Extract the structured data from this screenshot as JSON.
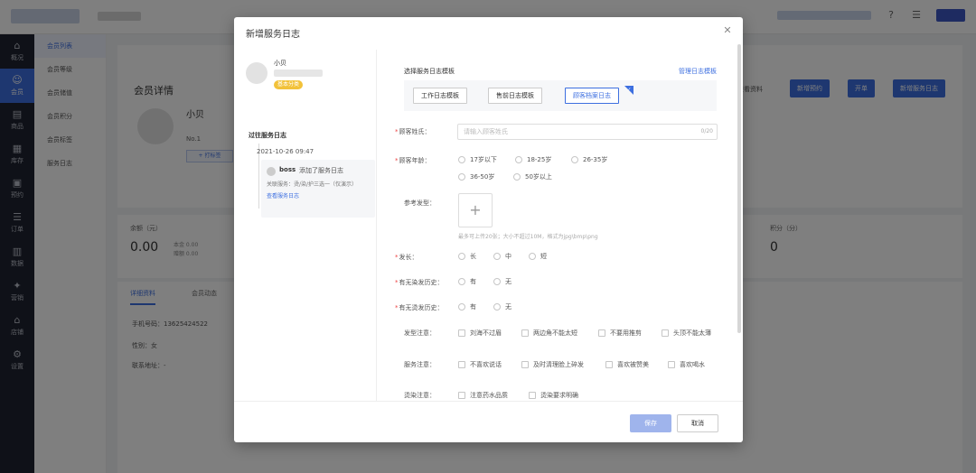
{
  "topbar": {
    "icons": [
      "help-icon",
      "menu-icon"
    ]
  },
  "sidebar": {
    "items": [
      {
        "label": "概况",
        "icon": "home-icon",
        "glyph": "⌂"
      },
      {
        "label": "会员",
        "icon": "member-icon",
        "glyph": "☺"
      },
      {
        "label": "商品",
        "icon": "goods-icon",
        "glyph": "▤"
      },
      {
        "label": "库存",
        "icon": "stock-icon",
        "glyph": "▦"
      },
      {
        "label": "预约",
        "icon": "calendar-icon",
        "glyph": "▣"
      },
      {
        "label": "订单",
        "icon": "order-icon",
        "glyph": "☰"
      },
      {
        "label": "数据",
        "icon": "chart-icon",
        "glyph": "▥"
      },
      {
        "label": "营销",
        "icon": "marketing-icon",
        "glyph": "✦"
      },
      {
        "label": "店铺",
        "icon": "shop-icon",
        "glyph": "⌂"
      },
      {
        "label": "设置",
        "icon": "settings-icon",
        "glyph": "⚙"
      }
    ]
  },
  "subnav": {
    "items": [
      "会员列表",
      "会员等级",
      "会员储值",
      "会员积分",
      "会员标签",
      "服务日志"
    ]
  },
  "member": {
    "page_title": "会员详情",
    "name": "小贝",
    "no": "No.1",
    "tag_btn": "+ 打标签",
    "actions": {
      "more": "查看资料",
      "reserve": "新增预约",
      "bill": "开单",
      "add_log": "新增服务日志"
    }
  },
  "stats": {
    "balance_label": "余额（元）",
    "balance_value": "0.00",
    "balance_principal": "本金 0.00",
    "balance_gift": "赠额 0.00",
    "points_label": "积分（分）",
    "points_value": "0"
  },
  "detail": {
    "tabs": [
      "详细资料",
      "会员动态"
    ],
    "phone": "手机号码：13625424522",
    "gender": "性别：女",
    "address": "联系地址：-"
  },
  "modal": {
    "title": "新增服务日志",
    "customer": {
      "name": "小贝",
      "level": "基本分类"
    },
    "history": {
      "title": "过往服务日志",
      "date": "2021-10-26 09:47",
      "user": "boss",
      "action": "添加了服务日志",
      "detail": "关联服务：烫/染/护三选一（仅演示）",
      "link": "查看服务日志"
    },
    "template": {
      "label": "选择服务日志模板",
      "manage": "管理日志模板",
      "options": [
        "工作日志模板",
        "售前日志模板",
        "顾客档案日志"
      ],
      "selected": 2
    },
    "fields": {
      "name_label": "顾客姓氏：",
      "name_placeholder": "请输入顾客姓氏",
      "name_count": "0/20",
      "age_label": "顾客年龄：",
      "age_options": [
        "17岁以下",
        "18-25岁",
        "26-35岁",
        "36-50岁",
        "50岁以上"
      ],
      "ref_label": "参考发型：",
      "upload_glyph": "+",
      "upload_hint": "最多可上传20张；大小不超过10M，格式为jpg\\bmp\\png",
      "hair_label": "发长：",
      "hair_options": [
        "长",
        "中",
        "短"
      ],
      "dye_label": "有无染发历史：",
      "perm_label": "有无烫发历史：",
      "yes": "有",
      "no": "无",
      "style_note_label": "发型注意：",
      "style_notes": [
        "刘海不过眉",
        "两边角不能太短",
        "不要用推剪",
        "头顶不能太薄"
      ],
      "service_note_label": "服务注意：",
      "service_notes": [
        "不喜欢说话",
        "及时清理脸上碎发",
        "喜欢被赞美",
        "喜欢喝水"
      ],
      "perm_note_label": "烫染注意：",
      "perm_notes": [
        "注意药水品质",
        "烫染要求明确"
      ]
    },
    "buttons": {
      "save": "保存",
      "cancel": "取消"
    }
  }
}
